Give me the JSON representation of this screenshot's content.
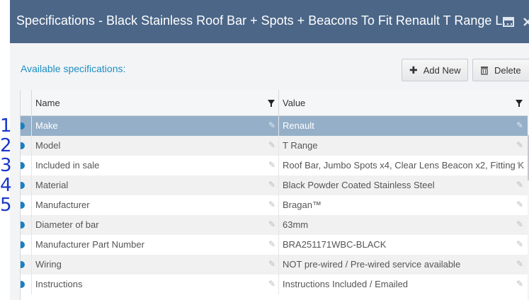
{
  "window": {
    "title": "Specifications - Black Stainless Roof Bar + Spots + Beacons To Fit Renault T Range L..."
  },
  "toolbar": {
    "available_label": "Available specifications:",
    "add_new_label": "Add New",
    "delete_label": "Delete"
  },
  "grid": {
    "columns": [
      "Name",
      "Value"
    ],
    "rows": [
      {
        "name": "Make",
        "value": "Renault",
        "selected": true
      },
      {
        "name": "Model",
        "value": "T Range"
      },
      {
        "name": "Included in sale",
        "value": "Roof Bar, Jumbo Spots x4, Clear Lens Beacon x2, Fitting K"
      },
      {
        "name": "Material",
        "value": "Black Powder Coated Stainless Steel"
      },
      {
        "name": "Manufacturer",
        "value": "Bragan™"
      },
      {
        "name": "Diameter of bar",
        "value": "63mm"
      },
      {
        "name": "Manufacturer Part Number",
        "value": "BRA251171WBC-BLACK"
      },
      {
        "name": "Wiring",
        "value": "NOT pre-wired / Pre-wired service available"
      },
      {
        "name": "Instructions",
        "value": "Instructions Included / Emailed"
      }
    ]
  },
  "annotations": [
    "1",
    "2",
    "3",
    "4",
    "5"
  ],
  "colors": {
    "titlebar": "#4b6687",
    "accent": "#1d8fc4",
    "selected_row": "#95afc8"
  }
}
